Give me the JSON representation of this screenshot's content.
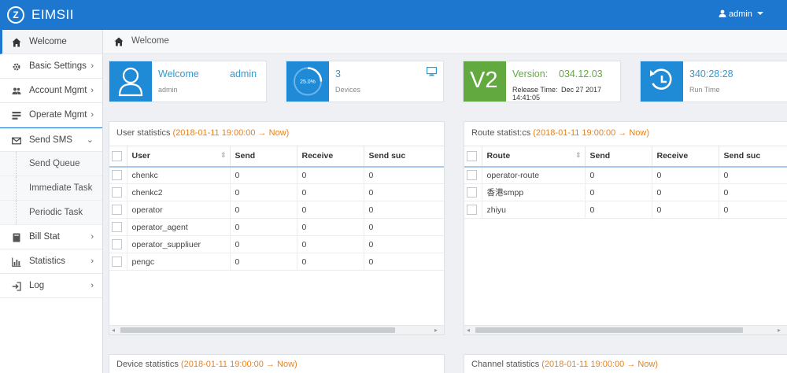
{
  "header": {
    "logo_text": "Z",
    "app_title": "EIMSII",
    "user": "admin"
  },
  "sidebar": {
    "items": [
      {
        "label": "Welcome",
        "icon": "home-icon"
      },
      {
        "label": "Basic Settings",
        "icon": "gear-icon"
      },
      {
        "label": "Account Mgmt",
        "icon": "users-icon"
      },
      {
        "label": "Operate Mgmt",
        "icon": "list-icon"
      },
      {
        "label": "Send SMS",
        "icon": "envelope-icon"
      },
      {
        "label": "Bill Stat",
        "icon": "book-icon"
      },
      {
        "label": "Statistics",
        "icon": "bar-chart-icon"
      },
      {
        "label": "Log",
        "icon": "signin-icon"
      }
    ],
    "sub_items": [
      "Send Queue",
      "Immediate Task",
      "Periodic Task"
    ]
  },
  "breadcrumb": {
    "label": "Welcome"
  },
  "cards": {
    "welcome": {
      "title": "Welcome",
      "user": "admin",
      "sub": "admin"
    },
    "devices": {
      "percent": "25.0%",
      "count": "3",
      "sub": "Devices"
    },
    "version": {
      "badge": "V2",
      "label": "Version:",
      "value": "034.12.03",
      "release_label": "Release Time:",
      "release_value": "Dec 27 2017",
      "release_time": "14:41:05"
    },
    "runtime": {
      "value": "340:28:28",
      "sub": "Run Time"
    }
  },
  "user_stats": {
    "title": "User statistics",
    "range": "(2018-01-11 19:00:00 → Now)",
    "columns": [
      "User",
      "Send",
      "Receive",
      "Send suc"
    ],
    "rows": [
      [
        "chenkc",
        "0",
        "0",
        "0"
      ],
      [
        "chenkc2",
        "0",
        "0",
        "0"
      ],
      [
        "operator",
        "0",
        "0",
        "0"
      ],
      [
        "operator_agent",
        "0",
        "0",
        "0"
      ],
      [
        "operator_suppliuer",
        "0",
        "0",
        "0"
      ],
      [
        "pengc",
        "0",
        "0",
        "0"
      ]
    ]
  },
  "route_stats": {
    "title": "Route statist:cs",
    "range": "(2018-01-11 19:00:00 → Now)",
    "columns": [
      "Route",
      "Send",
      "Receive",
      "Send suc"
    ],
    "rows": [
      [
        "operator-route",
        "0",
        "0",
        "0"
      ],
      [
        "香港smpp",
        "0",
        "0",
        "0"
      ],
      [
        "zhiyu",
        "0",
        "0",
        "0"
      ]
    ]
  },
  "device_stats": {
    "title": "Device statistics",
    "range": "(2018-01-11 19:00:00 → Now)"
  },
  "channel_stats": {
    "title": "Channel statistics",
    "range": "(2018-01-11 19:00:00 → Now)"
  },
  "colors": {
    "primary": "#1e77cf",
    "card_blue": "#1f8ad6",
    "card_green": "#62aa3f",
    "range_orange": "#e8811b"
  }
}
